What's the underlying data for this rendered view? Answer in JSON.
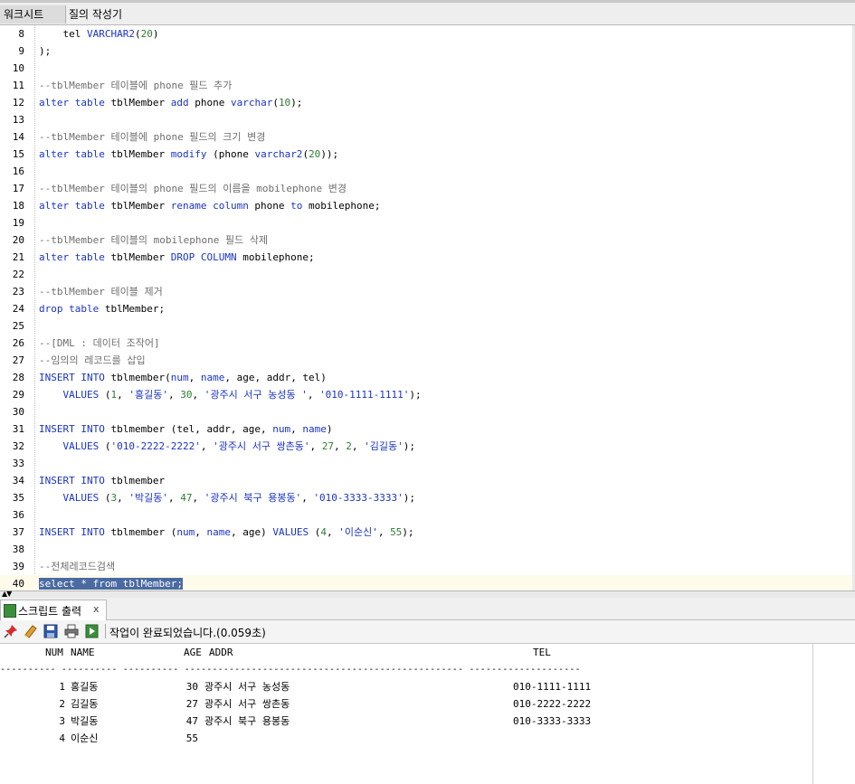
{
  "tabs": {
    "worksheet": "워크시트",
    "query_builder": "질의 작성기"
  },
  "editor": {
    "lines": [
      {
        "n": "8",
        "tokens": [
          {
            "t": "    tel ",
            "c": ""
          },
          {
            "t": "VARCHAR2",
            "c": "kw"
          },
          {
            "t": "(",
            "c": ""
          },
          {
            "t": "20",
            "c": "num"
          },
          {
            "t": ")",
            "c": ""
          }
        ]
      },
      {
        "n": "9",
        "tokens": [
          {
            "t": ");",
            "c": ""
          }
        ]
      },
      {
        "n": "10",
        "tokens": []
      },
      {
        "n": "11",
        "tokens": [
          {
            "t": "--tblMember 테이블에 phone 필드 추가",
            "c": "cm"
          }
        ]
      },
      {
        "n": "12",
        "tokens": [
          {
            "t": "alter table",
            "c": "kw"
          },
          {
            "t": " tblMember ",
            "c": ""
          },
          {
            "t": "add",
            "c": "kw"
          },
          {
            "t": " phone ",
            "c": ""
          },
          {
            "t": "varchar",
            "c": "kw"
          },
          {
            "t": "(",
            "c": ""
          },
          {
            "t": "10",
            "c": "num"
          },
          {
            "t": ");",
            "c": ""
          }
        ]
      },
      {
        "n": "13",
        "tokens": []
      },
      {
        "n": "14",
        "tokens": [
          {
            "t": "--tblMember 테이블에 phone 필드의 크기 변경",
            "c": "cm"
          }
        ]
      },
      {
        "n": "15",
        "tokens": [
          {
            "t": "alter table",
            "c": "kw"
          },
          {
            "t": " tblMember ",
            "c": ""
          },
          {
            "t": "modify",
            "c": "kw"
          },
          {
            "t": " (phone ",
            "c": ""
          },
          {
            "t": "varchar2",
            "c": "kw"
          },
          {
            "t": "(",
            "c": ""
          },
          {
            "t": "20",
            "c": "num"
          },
          {
            "t": "));",
            "c": ""
          }
        ]
      },
      {
        "n": "16",
        "tokens": []
      },
      {
        "n": "17",
        "tokens": [
          {
            "t": "--tblMember 테이블의 phone 필드의 이름을 mobilephone 변경",
            "c": "cm"
          }
        ]
      },
      {
        "n": "18",
        "tokens": [
          {
            "t": "alter table",
            "c": "kw"
          },
          {
            "t": " tblMember ",
            "c": ""
          },
          {
            "t": "rename column",
            "c": "kw"
          },
          {
            "t": " phone ",
            "c": ""
          },
          {
            "t": "to",
            "c": "kw"
          },
          {
            "t": " mobilephone;",
            "c": ""
          }
        ]
      },
      {
        "n": "19",
        "tokens": []
      },
      {
        "n": "20",
        "tokens": [
          {
            "t": "--tblMember 테이블의 mobilephone 필드 삭제",
            "c": "cm"
          }
        ]
      },
      {
        "n": "21",
        "tokens": [
          {
            "t": "alter table",
            "c": "kw"
          },
          {
            "t": " tblMember ",
            "c": ""
          },
          {
            "t": "DROP COLUMN",
            "c": "kw"
          },
          {
            "t": " mobilephone;",
            "c": ""
          }
        ]
      },
      {
        "n": "22",
        "tokens": []
      },
      {
        "n": "23",
        "tokens": [
          {
            "t": "--tblMember 테이블 제거",
            "c": "cm"
          }
        ]
      },
      {
        "n": "24",
        "tokens": [
          {
            "t": "drop table",
            "c": "kw"
          },
          {
            "t": " tblMember;",
            "c": ""
          }
        ]
      },
      {
        "n": "25",
        "tokens": []
      },
      {
        "n": "26",
        "tokens": [
          {
            "t": "--[DML : 데이터 조작어]",
            "c": "cm"
          }
        ]
      },
      {
        "n": "27",
        "tokens": [
          {
            "t": "--임의의 레코드를 삽입",
            "c": "cm"
          }
        ]
      },
      {
        "n": "28",
        "tokens": [
          {
            "t": "INSERT INTO",
            "c": "kw"
          },
          {
            "t": " tblmember(",
            "c": ""
          },
          {
            "t": "num",
            "c": "kw"
          },
          {
            "t": ", ",
            "c": ""
          },
          {
            "t": "name",
            "c": "kw"
          },
          {
            "t": ", age, addr, tel)",
            "c": ""
          }
        ]
      },
      {
        "n": "29",
        "tokens": [
          {
            "t": "    ",
            "c": ""
          },
          {
            "t": "VALUES",
            "c": "kw"
          },
          {
            "t": " (",
            "c": ""
          },
          {
            "t": "1",
            "c": "num"
          },
          {
            "t": ", ",
            "c": ""
          },
          {
            "t": "'홍길동'",
            "c": "str"
          },
          {
            "t": ", ",
            "c": ""
          },
          {
            "t": "30",
            "c": "num"
          },
          {
            "t": ", ",
            "c": ""
          },
          {
            "t": "'광주시 서구 농성동 '",
            "c": "str"
          },
          {
            "t": ", ",
            "c": ""
          },
          {
            "t": "'010-1111-1111'",
            "c": "str"
          },
          {
            "t": ");",
            "c": ""
          }
        ]
      },
      {
        "n": "30",
        "tokens": []
      },
      {
        "n": "31",
        "tokens": [
          {
            "t": "INSERT INTO",
            "c": "kw"
          },
          {
            "t": " tblmember (tel, addr, age, ",
            "c": ""
          },
          {
            "t": "num",
            "c": "kw"
          },
          {
            "t": ", ",
            "c": ""
          },
          {
            "t": "name",
            "c": "kw"
          },
          {
            "t": ")",
            "c": ""
          }
        ]
      },
      {
        "n": "32",
        "tokens": [
          {
            "t": "    ",
            "c": ""
          },
          {
            "t": "VALUES",
            "c": "kw"
          },
          {
            "t": " (",
            "c": ""
          },
          {
            "t": "'010-2222-2222'",
            "c": "str"
          },
          {
            "t": ", ",
            "c": ""
          },
          {
            "t": "'광주시 서구 쌍촌동'",
            "c": "str"
          },
          {
            "t": ", ",
            "c": ""
          },
          {
            "t": "27",
            "c": "num"
          },
          {
            "t": ", ",
            "c": ""
          },
          {
            "t": "2",
            "c": "num"
          },
          {
            "t": ", ",
            "c": ""
          },
          {
            "t": "'김길동'",
            "c": "str"
          },
          {
            "t": ");",
            "c": ""
          }
        ]
      },
      {
        "n": "33",
        "tokens": []
      },
      {
        "n": "34",
        "tokens": [
          {
            "t": "INSERT INTO",
            "c": "kw"
          },
          {
            "t": " tblmember",
            "c": ""
          }
        ]
      },
      {
        "n": "35",
        "tokens": [
          {
            "t": "    ",
            "c": ""
          },
          {
            "t": "VALUES",
            "c": "kw"
          },
          {
            "t": " (",
            "c": ""
          },
          {
            "t": "3",
            "c": "num"
          },
          {
            "t": ", ",
            "c": ""
          },
          {
            "t": "'박길동'",
            "c": "str"
          },
          {
            "t": ", ",
            "c": ""
          },
          {
            "t": "47",
            "c": "num"
          },
          {
            "t": ", ",
            "c": ""
          },
          {
            "t": "'광주시 북구 용봉동'",
            "c": "str"
          },
          {
            "t": ", ",
            "c": ""
          },
          {
            "t": "'010-3333-3333'",
            "c": "str"
          },
          {
            "t": ");",
            "c": ""
          }
        ]
      },
      {
        "n": "36",
        "tokens": []
      },
      {
        "n": "37",
        "tokens": [
          {
            "t": "INSERT INTO",
            "c": "kw"
          },
          {
            "t": " tblmember (",
            "c": ""
          },
          {
            "t": "num",
            "c": "kw"
          },
          {
            "t": ", ",
            "c": ""
          },
          {
            "t": "name",
            "c": "kw"
          },
          {
            "t": ", age) ",
            "c": ""
          },
          {
            "t": "VALUES",
            "c": "kw"
          },
          {
            "t": " (",
            "c": ""
          },
          {
            "t": "4",
            "c": "num"
          },
          {
            "t": ", ",
            "c": ""
          },
          {
            "t": "'이순신'",
            "c": "str"
          },
          {
            "t": ", ",
            "c": ""
          },
          {
            "t": "55",
            "c": "num"
          },
          {
            "t": ");",
            "c": ""
          }
        ]
      },
      {
        "n": "38",
        "tokens": []
      },
      {
        "n": "39",
        "tokens": [
          {
            "t": "--전체레코드검색",
            "c": "cm"
          }
        ]
      },
      {
        "n": "40",
        "tokens": [
          {
            "t": "select * from tblMember;",
            "c": "sel"
          }
        ],
        "current": true
      }
    ]
  },
  "output": {
    "tab_label": "스크립트 출력",
    "close_label": "x",
    "status": "작업이 완료되었습니다.(0.059초)",
    "header": {
      "num": "NUM",
      "name": "NAME",
      "age": "AGE",
      "addr": "ADDR",
      "tel": "TEL"
    },
    "separator": "---------- ---------- ---------- -------------------------------------------------- --------------------",
    "rows": [
      {
        "num": "1",
        "name": "홍길동",
        "age": "30",
        "addr": "광주시 서구 농성동",
        "tel": "010-1111-1111"
      },
      {
        "num": "2",
        "name": "김길동",
        "age": "27",
        "addr": "광주시 서구 쌍촌동",
        "tel": "010-2222-2222"
      },
      {
        "num": "3",
        "name": "박길동",
        "age": "47",
        "addr": "광주시 북구 용봉동",
        "tel": "010-3333-3333"
      },
      {
        "num": "4",
        "name": "이순신",
        "age": "55",
        "addr": "",
        "tel": ""
      }
    ]
  },
  "icons": [
    "pin-icon",
    "eraser-icon",
    "save-icon",
    "print-icon",
    "load-icon"
  ],
  "colors": {
    "keyword": "#1a34c4",
    "number": "#2e7d32",
    "comment": "#6e6e6e",
    "selection": "#4a6aa1"
  }
}
